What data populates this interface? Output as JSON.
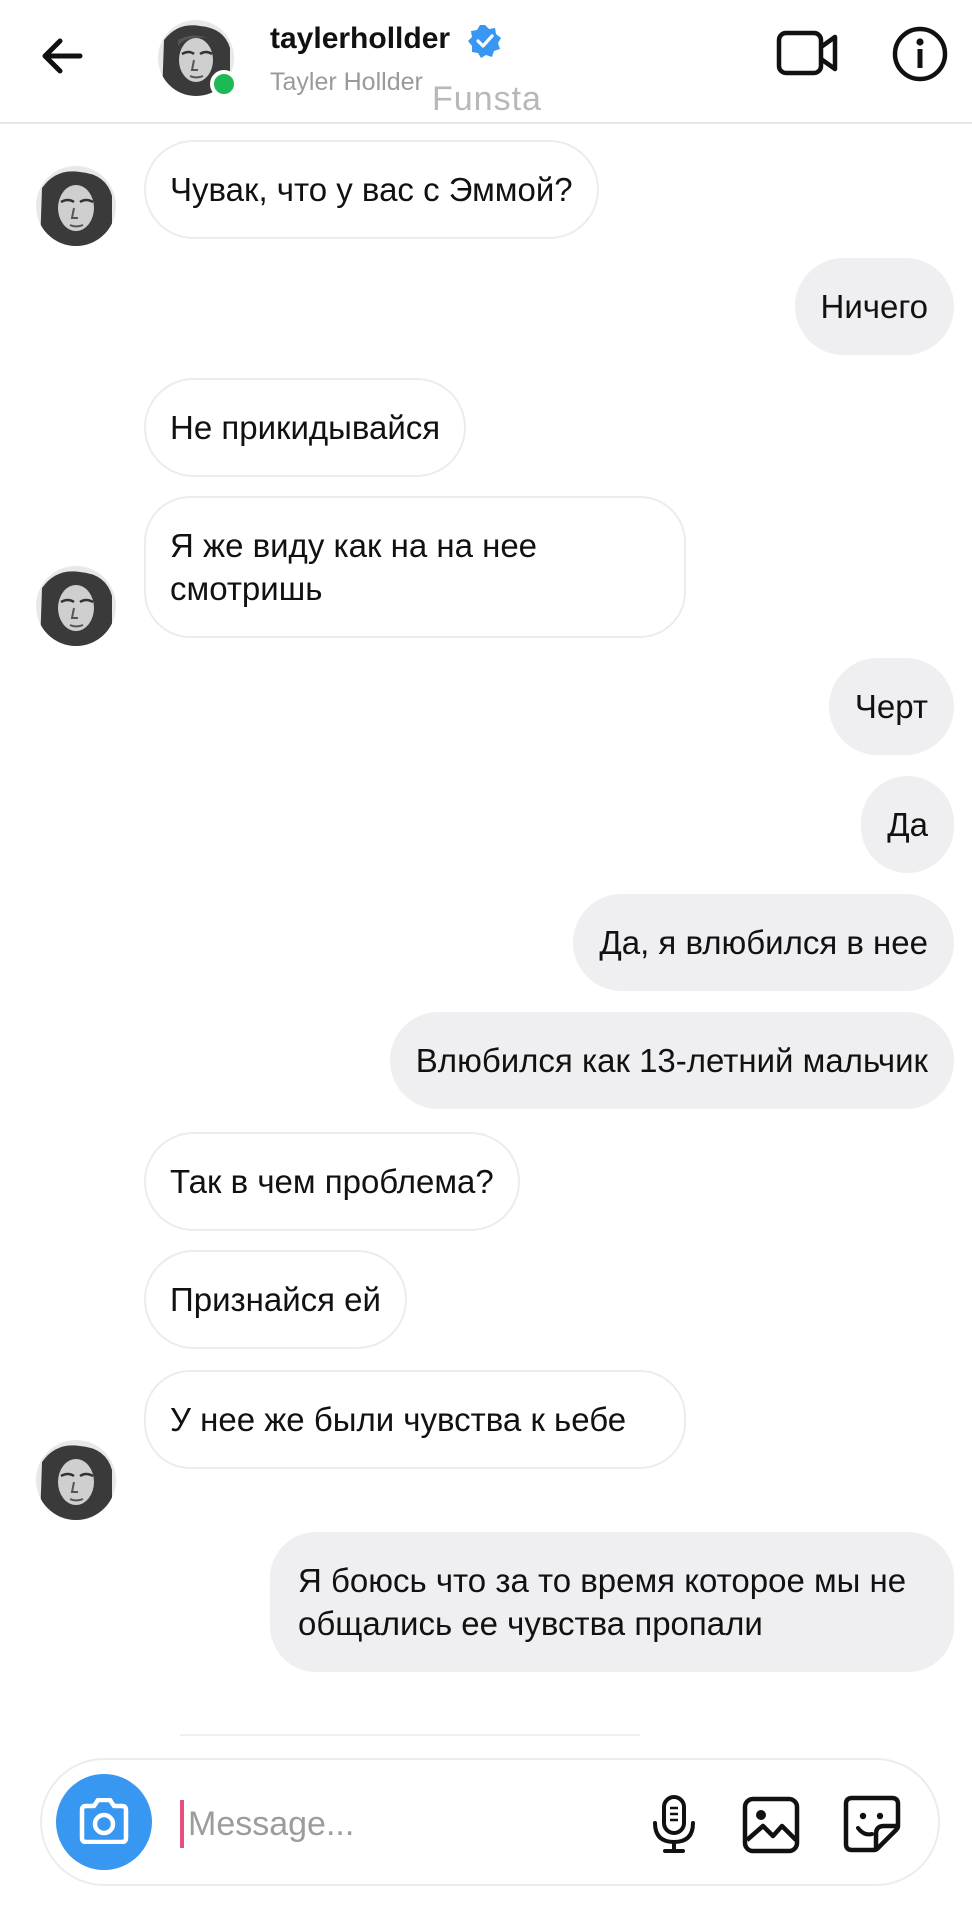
{
  "header": {
    "username": "taylerhollder",
    "full_name": "Tayler Hollder",
    "watermark": "Funsta",
    "verified": true,
    "online": true,
    "icons": {
      "back": "arrow-left-icon",
      "video": "video-camera-icon",
      "info": "info-icon",
      "verified": "verified-badge-icon"
    }
  },
  "messages": [
    {
      "side": "in",
      "text": "Чувак, что у вас с Эммой?"
    },
    {
      "side": "out",
      "text": "Ничего"
    },
    {
      "side": "in",
      "text": "Не прикидывайся"
    },
    {
      "side": "in",
      "text": "Я же виду как на на нее смотришь"
    },
    {
      "side": "out",
      "text": "Черт"
    },
    {
      "side": "out",
      "text": "Да"
    },
    {
      "side": "out",
      "text": "Да, я влюбился в нее"
    },
    {
      "side": "out",
      "text": "Влюбился как 13-летний мальчик"
    },
    {
      "side": "in",
      "text": "Так в чем проблема?"
    },
    {
      "side": "in",
      "text": "Признайся ей"
    },
    {
      "side": "in",
      "text": "У нее же были чувства к ьебе"
    },
    {
      "side": "out",
      "text": "Я боюсь что за то время которое мы не общались ее чувства пропали"
    }
  ],
  "composer": {
    "placeholder": "Message...",
    "value": "",
    "icons": [
      "camera-icon",
      "microphone-icon",
      "gallery-icon",
      "sticker-icon"
    ]
  },
  "colors": {
    "accent_blue": "#3897f0",
    "verified_blue": "#3897f0",
    "online_green": "#1db954",
    "outgoing_bubble": "#efeef0",
    "cursor_pink": "#e6507d"
  }
}
